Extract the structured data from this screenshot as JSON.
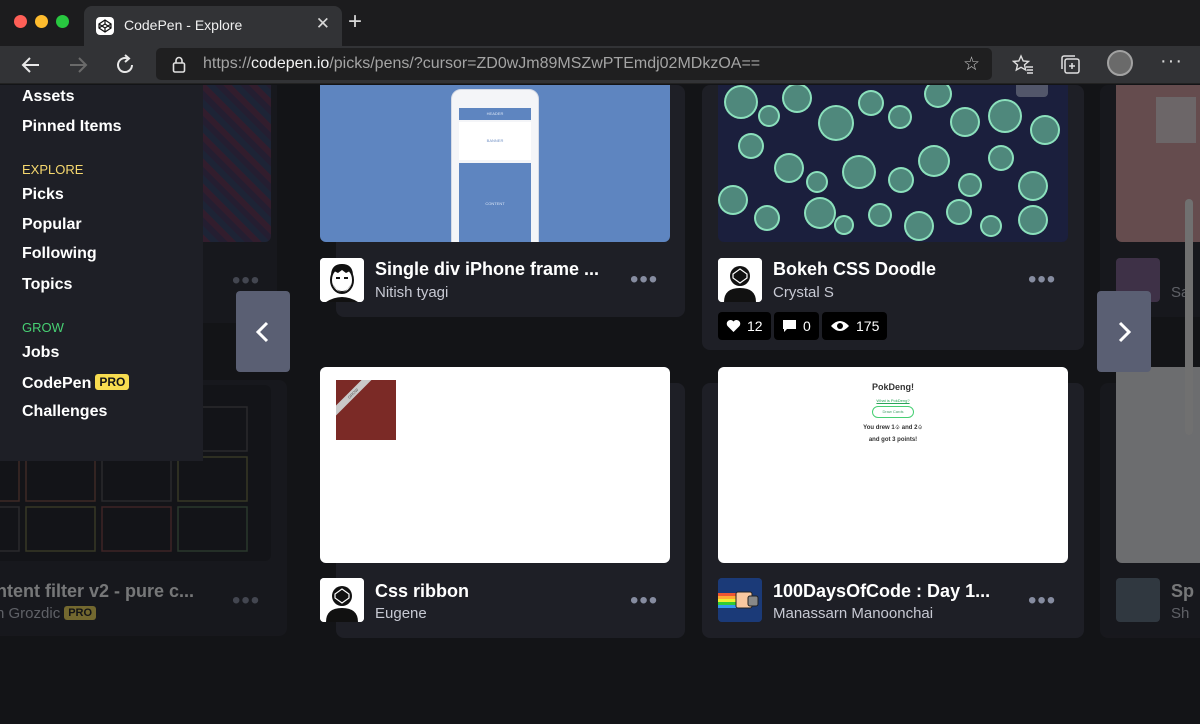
{
  "browser": {
    "tab_title": "CodePen - Explore",
    "url_host": "codepen.io",
    "url_prefix": "https://",
    "url_path": "/picks/pens/?cursor=ZD0wJm89MSZwPTEmdj02MDkzOA=="
  },
  "sidebar": {
    "items_top": [
      "Assets",
      "Pinned Items"
    ],
    "explore_heading": "EXPLORE",
    "explore_items": [
      "Picks",
      "Popular",
      "Following",
      "Topics"
    ],
    "grow_heading": "GROW",
    "grow_items": [
      "Jobs",
      "CodePen",
      "Challenges"
    ],
    "pro_label": "PRO"
  },
  "cards": [
    {
      "title": "Single div iPhone frame ...",
      "author": "Nitish tyagi",
      "preview": {
        "header": "HEADER",
        "banner": "BANNER",
        "content": "CONTENT"
      }
    },
    {
      "title": "Bokeh CSS Doodle",
      "author": "Crystal S",
      "stats": {
        "likes": "12",
        "comments": "0",
        "views": "175"
      }
    },
    {
      "title": "Css ribbon",
      "author": "Eugene",
      "preview": {
        "ribbon": "GROW"
      }
    },
    {
      "title": "100DaysOfCode : Day 1...",
      "author": "Manassarn Manoonchai",
      "preview": {
        "heading": "PokDeng!",
        "link": "What is PokDeng?",
        "button": "Draw Cards",
        "line1": "You drew 1♤ and 2♤",
        "line2": "and got 3 points!"
      }
    }
  ],
  "left_partial_card": {
    "title": "ntent filter v2 - pure c...",
    "author": "n Grozdic",
    "pro": "PRO"
  },
  "right_partial_card": {
    "title_frag": "Sp",
    "author_frag1": "Sa",
    "author_frag2": "Sh"
  },
  "colors": {
    "accent_explore": "#f5d76e",
    "accent_grow": "#47cf73",
    "pro_yellow": "#f7dc50",
    "card_bg": "#1e1f26"
  }
}
